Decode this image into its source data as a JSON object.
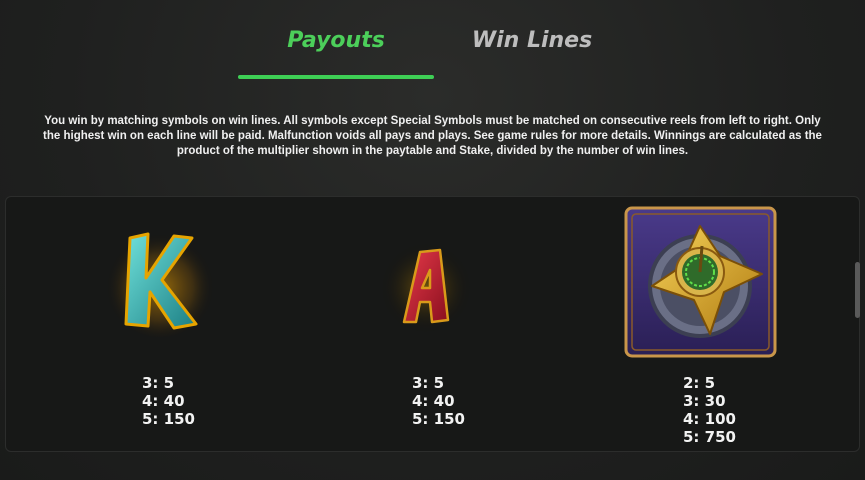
{
  "tabs": {
    "payouts_label": "Payouts",
    "win_lines_label": "Win Lines"
  },
  "rules_text": "You win by matching symbols on win lines. All symbols except Special Symbols must be matched on consecutive reels from left to right. Only the highest win on each line will be paid. Malfunction voids all pays and plays. See game rules for more details. Winnings are calculated as the product of the multiplier shown in the paytable and Stake, divided by the number of win lines.",
  "symbols": [
    {
      "name": "K",
      "icon": "letter-k-icon",
      "color": "#2aa7a5",
      "pays": [
        "3: 5",
        "4: 40",
        "5: 150"
      ]
    },
    {
      "name": "A",
      "icon": "letter-a-icon",
      "color": "#b81d2e",
      "pays": [
        "3: 5",
        "4: 40",
        "5: 150"
      ]
    },
    {
      "name": "Compass",
      "icon": "golden-compass-icon",
      "color": "#3b2a6e",
      "pays": [
        "2: 5",
        "3: 30",
        "4: 100",
        "5: 750"
      ]
    }
  ],
  "colors": {
    "accent": "#4ccf5a",
    "inactive_tab": "#bdbdbd"
  }
}
